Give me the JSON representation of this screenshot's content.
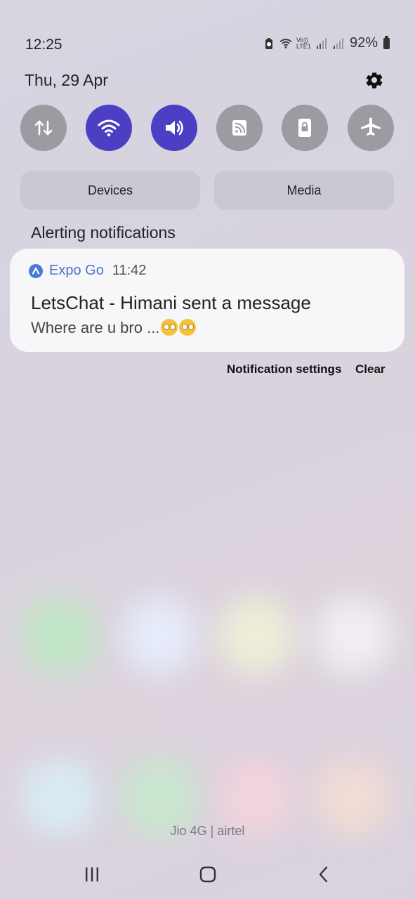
{
  "status": {
    "time": "12:25",
    "volte_label": "Vo)) LTE1",
    "battery": "92%"
  },
  "panel": {
    "date": "Thu, 29 Apr",
    "toggles": [
      {
        "name": "mobile-data",
        "icon": "data-transfer-icon",
        "state": "off"
      },
      {
        "name": "wifi",
        "icon": "wifi-icon",
        "state": "on"
      },
      {
        "name": "sound",
        "icon": "speaker-icon",
        "state": "on"
      },
      {
        "name": "rss",
        "icon": "rss-icon",
        "state": "off"
      },
      {
        "name": "lock",
        "icon": "portrait-lock-icon",
        "state": "off"
      },
      {
        "name": "airplane",
        "icon": "airplane-icon",
        "state": "off"
      }
    ],
    "devices_label": "Devices",
    "media_label": "Media"
  },
  "notifications": {
    "section_title": "Alerting notifications",
    "item": {
      "app_name": "Expo Go",
      "time": "11:42",
      "title": "LetsChat - Himani sent a message",
      "body": "Where are u bro ..."
    },
    "settings_label": "Notification settings",
    "clear_label": "Clear"
  },
  "carrier": "Jio 4G | airtel",
  "colors": {
    "accent": "#4d3fc3",
    "toggle_off": "#9b9ba2",
    "app_name": "#4a73c9"
  }
}
